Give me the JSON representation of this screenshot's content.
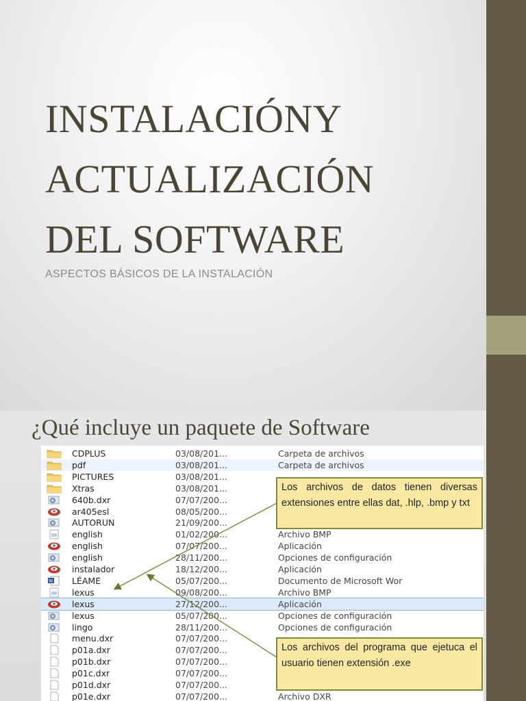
{
  "slide1": {
    "title_lines": [
      "INSTALACIÓNY",
      "ACTUALIZACIÓN",
      "DEL SOFTWARE"
    ],
    "subtitle": "ASPECTOS BÁSICOS DE LA INSTALACIÓN"
  },
  "slide2": {
    "heading": "¿Qué incluye un paquete de Software",
    "files": [
      {
        "icon": "folder-icon",
        "name": "CDPLUS",
        "date": "03/08/201...",
        "type": "Carpeta de archivos",
        "state": ""
      },
      {
        "icon": "folder-icon",
        "name": "pdf",
        "date": "03/08/201...",
        "type": "Carpeta de archivos",
        "state": "hl"
      },
      {
        "icon": "folder-icon",
        "name": "PICTURES",
        "date": "03/08/201...",
        "type": "",
        "state": ""
      },
      {
        "icon": "folder-icon",
        "name": "Xtras",
        "date": "03/08/201...",
        "type": "",
        "state": ""
      },
      {
        "icon": "app-settings-icon",
        "name": "640b.dxr",
        "date": "07/07/200...",
        "type": "",
        "state": ""
      },
      {
        "icon": "app-exe-icon",
        "name": "ar405esl",
        "date": "08/05/200...",
        "type": "",
        "state": ""
      },
      {
        "icon": "app-settings-icon",
        "name": "AUTORUN",
        "date": "21/09/200...",
        "type": "",
        "state": ""
      },
      {
        "icon": "bmp-icon",
        "name": "english",
        "date": "01/02/200...",
        "type": "Archivo BMP",
        "state": ""
      },
      {
        "icon": "app-exe-icon",
        "name": "english",
        "date": "07/07/200...",
        "type": "Aplicación",
        "state": ""
      },
      {
        "icon": "app-settings-icon",
        "name": "english",
        "date": "28/11/200...",
        "type": "Opciones de configuración",
        "state": ""
      },
      {
        "icon": "app-exe-icon",
        "name": "instalador",
        "date": "18/12/200...",
        "type": "Aplicación",
        "state": ""
      },
      {
        "icon": "word-doc-icon",
        "name": "LÉAME",
        "date": "05/07/200...",
        "type": "Documento de Microsoft Wor",
        "state": ""
      },
      {
        "icon": "bmp-icon",
        "name": "lexus",
        "date": "09/08/200...",
        "type": "Archivo BMP",
        "state": ""
      },
      {
        "icon": "app-exe-icon",
        "name": "lexus",
        "date": "27/12/200...",
        "type": "Aplicación",
        "state": "selected"
      },
      {
        "icon": "app-settings-icon",
        "name": "lexus",
        "date": "05/07/200...",
        "type": "Opciones de configuración",
        "state": ""
      },
      {
        "icon": "app-settings-icon",
        "name": "lingo",
        "date": "28/11/200...",
        "type": "Opciones de configuración",
        "state": ""
      },
      {
        "icon": "blank-file-icon",
        "name": "menu.dxr",
        "date": "07/07/200...",
        "type": "",
        "state": ""
      },
      {
        "icon": "blank-file-icon",
        "name": "p01a.dxr",
        "date": "07/07/200...",
        "type": "",
        "state": ""
      },
      {
        "icon": "blank-file-icon",
        "name": "p01b.dxr",
        "date": "07/07/200...",
        "type": "",
        "state": ""
      },
      {
        "icon": "blank-file-icon",
        "name": "p01c.dxr",
        "date": "07/07/200...",
        "type": "",
        "state": ""
      },
      {
        "icon": "blank-file-icon",
        "name": "p01d.dxr",
        "date": "07/07/200...",
        "type": "",
        "state": ""
      },
      {
        "icon": "blank-file-icon",
        "name": "p01e.dxr",
        "date": "07/07/200...",
        "type": "Archivo DXR",
        "state": ""
      }
    ],
    "callout_data": "Los archivos de datos tienen diversas extensiones entre ellas dat, .hlp, .bmp y txt",
    "callout_program": "Los archivos del programa que ejetuca el usuario tienen extensión .exe"
  },
  "colors": {
    "sidebar": "#625a47",
    "sidebar_accent": "#a5a07e",
    "title": "#4b4535",
    "callout_bg": "#fbe9a3",
    "callout_border": "#7a8a3a",
    "selection": "#dbe9fb"
  }
}
